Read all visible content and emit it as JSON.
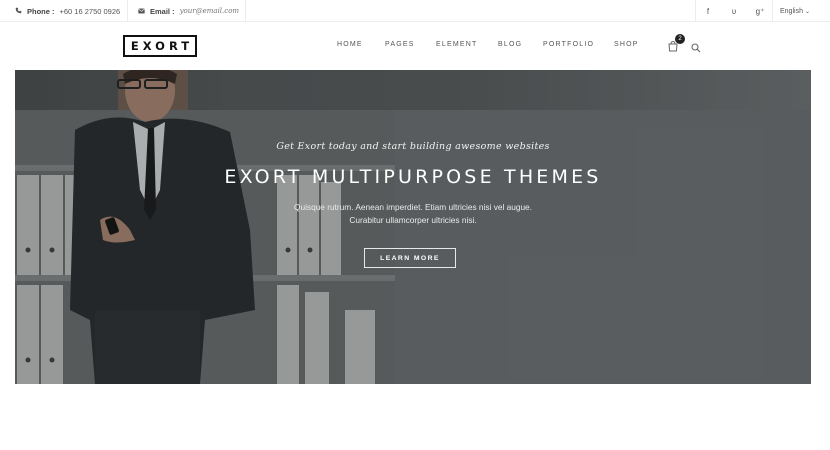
{
  "topbar": {
    "phone_icon": "phone-icon",
    "phone_label": "Phone :",
    "phone_value": "+60 16 2750 0926",
    "email_icon": "envelope-icon",
    "email_label": "Email :",
    "email_value": "your@email.com",
    "social": [
      {
        "icon": "facebook-icon",
        "glyph": "f"
      },
      {
        "icon": "twitter-icon",
        "glyph": "ʋ"
      },
      {
        "icon": "google-plus-icon",
        "glyph": "g⁺"
      }
    ],
    "language": "English"
  },
  "header": {
    "logo": "EXORT",
    "nav": [
      "HOME",
      "PAGES",
      "ELEMENT",
      "BLOG",
      "PORTFOLIO",
      "SHOP"
    ],
    "cart_count": "2"
  },
  "hero": {
    "tagline": "Get Exort today and start building awesome websites",
    "title": "EXORT MULTIPURPOSE THEMES",
    "desc_line1": "Quisque rutrum. Aenean imperdiet. Etiam ultricies nisi vel augue.",
    "desc_line2": "Curabitur ullamcorper ultricies nisi.",
    "button": "LEARN MORE"
  }
}
